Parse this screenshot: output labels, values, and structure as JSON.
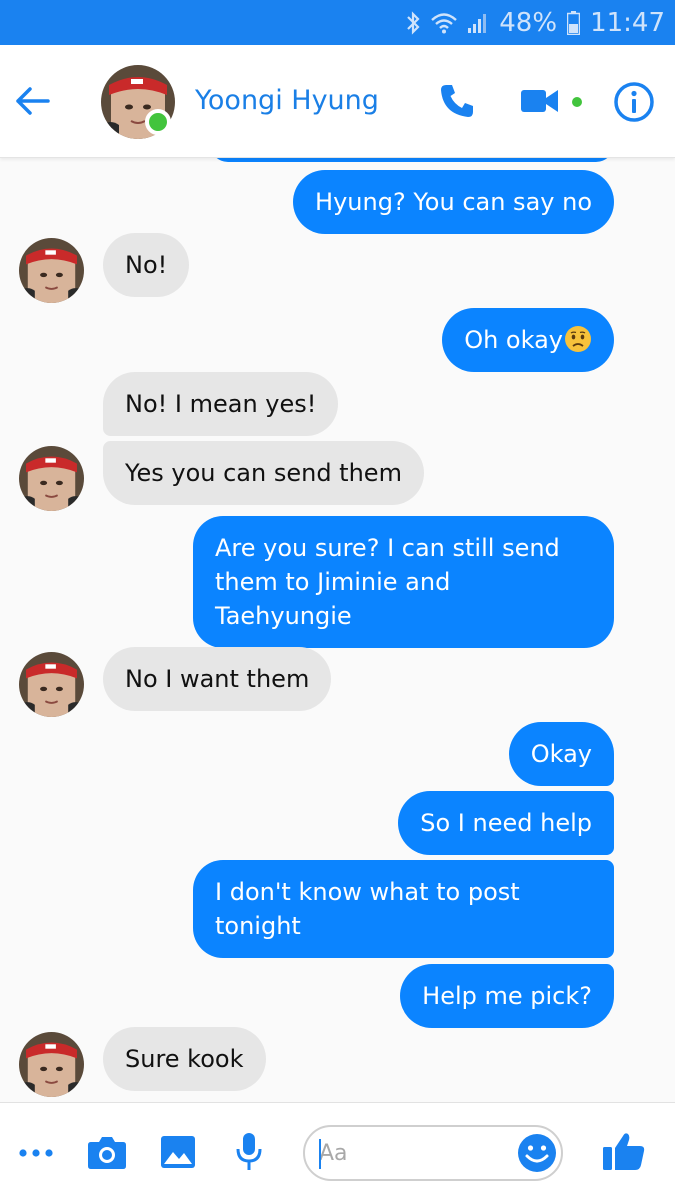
{
  "status_bar": {
    "battery": "48%",
    "time": "11:47"
  },
  "header": {
    "contact_name": "Yoongi Hyung",
    "online": true
  },
  "messages": [
    {
      "side": "out",
      "text": "Hyung? You can say no"
    },
    {
      "side": "in",
      "text": "No!"
    },
    {
      "side": "out",
      "text": "Oh okay",
      "emoji": "worried-face"
    },
    {
      "side": "in",
      "text": "No! I mean yes!"
    },
    {
      "side": "in",
      "text": "Yes you can send them"
    },
    {
      "side": "out",
      "text": "Are you sure? I can still send them to Jiminie and Taehyungie"
    },
    {
      "side": "in",
      "text": "No I want them"
    },
    {
      "side": "out",
      "text": "Okay"
    },
    {
      "side": "out",
      "text": "So I need help"
    },
    {
      "side": "out",
      "text": "I don't know what to post tonight"
    },
    {
      "side": "out",
      "text": "Help me pick?"
    },
    {
      "side": "in",
      "text": "Sure kook"
    }
  ],
  "composer": {
    "placeholder": "Aa"
  },
  "colors": {
    "accent": "#1a82f0",
    "outgoing_bubble": "#0b84ff",
    "incoming_bubble": "#e6e6e6",
    "online": "#42c43d"
  },
  "icons": {
    "back": "arrow-left",
    "call": "phone",
    "video": "video-camera",
    "info": "info-circle",
    "more": "ellipsis",
    "camera": "camera",
    "gallery": "image",
    "mic": "microphone",
    "emoji": "smiley",
    "like": "thumbs-up"
  }
}
